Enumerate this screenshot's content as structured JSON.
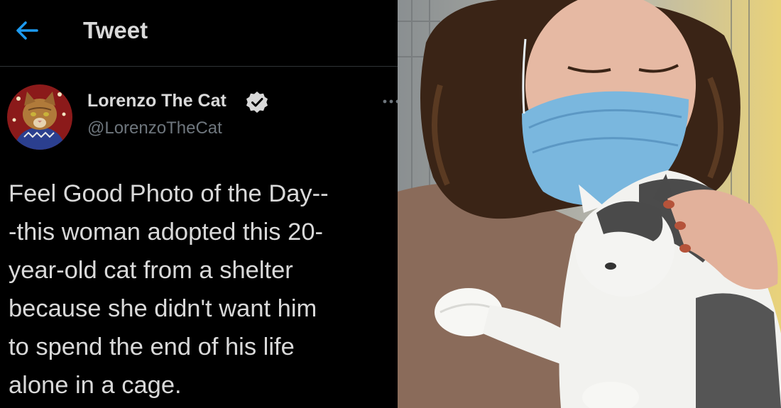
{
  "header": {
    "title": "Tweet",
    "back_icon": "arrow-left-icon"
  },
  "author": {
    "display_name": "Lorenzo The Cat",
    "handle": "@LorenzoTheCat",
    "verified_icon": "verified-badge-icon",
    "avatar_icon": "cat-avatar"
  },
  "tweet": {
    "text": "Feel Good Photo of the Day--\n-this woman adopted this 20-\nyear-old cat from a shelter\nbecause she didn't want him\nto spend the end of his life\nalone in a cage."
  },
  "colors": {
    "accent": "#1d9bf0",
    "text": "#d9d9d9",
    "muted": "#6e767d",
    "background": "#000000"
  }
}
